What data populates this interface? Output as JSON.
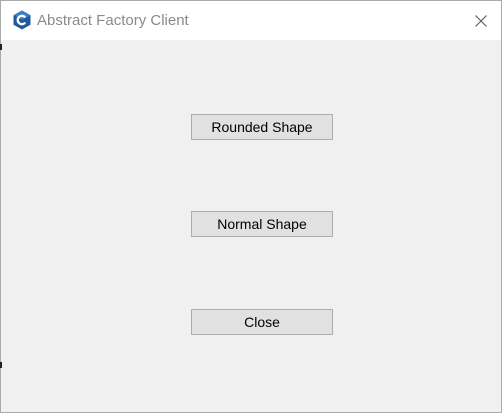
{
  "window": {
    "title": "Abstract Factory Client",
    "icon": "csharp-app-icon",
    "close_icon": "close-icon"
  },
  "buttons": {
    "rounded_shape": "Rounded Shape",
    "normal_shape": "Normal Shape",
    "close": "Close"
  },
  "colors": {
    "client_background": "#f0f0f0",
    "titlebar_background": "#ffffff",
    "button_face": "#e1e1e1",
    "button_border": "#adadad",
    "title_text": "#8a8a8a",
    "icon_accent": "#1e5a99"
  }
}
